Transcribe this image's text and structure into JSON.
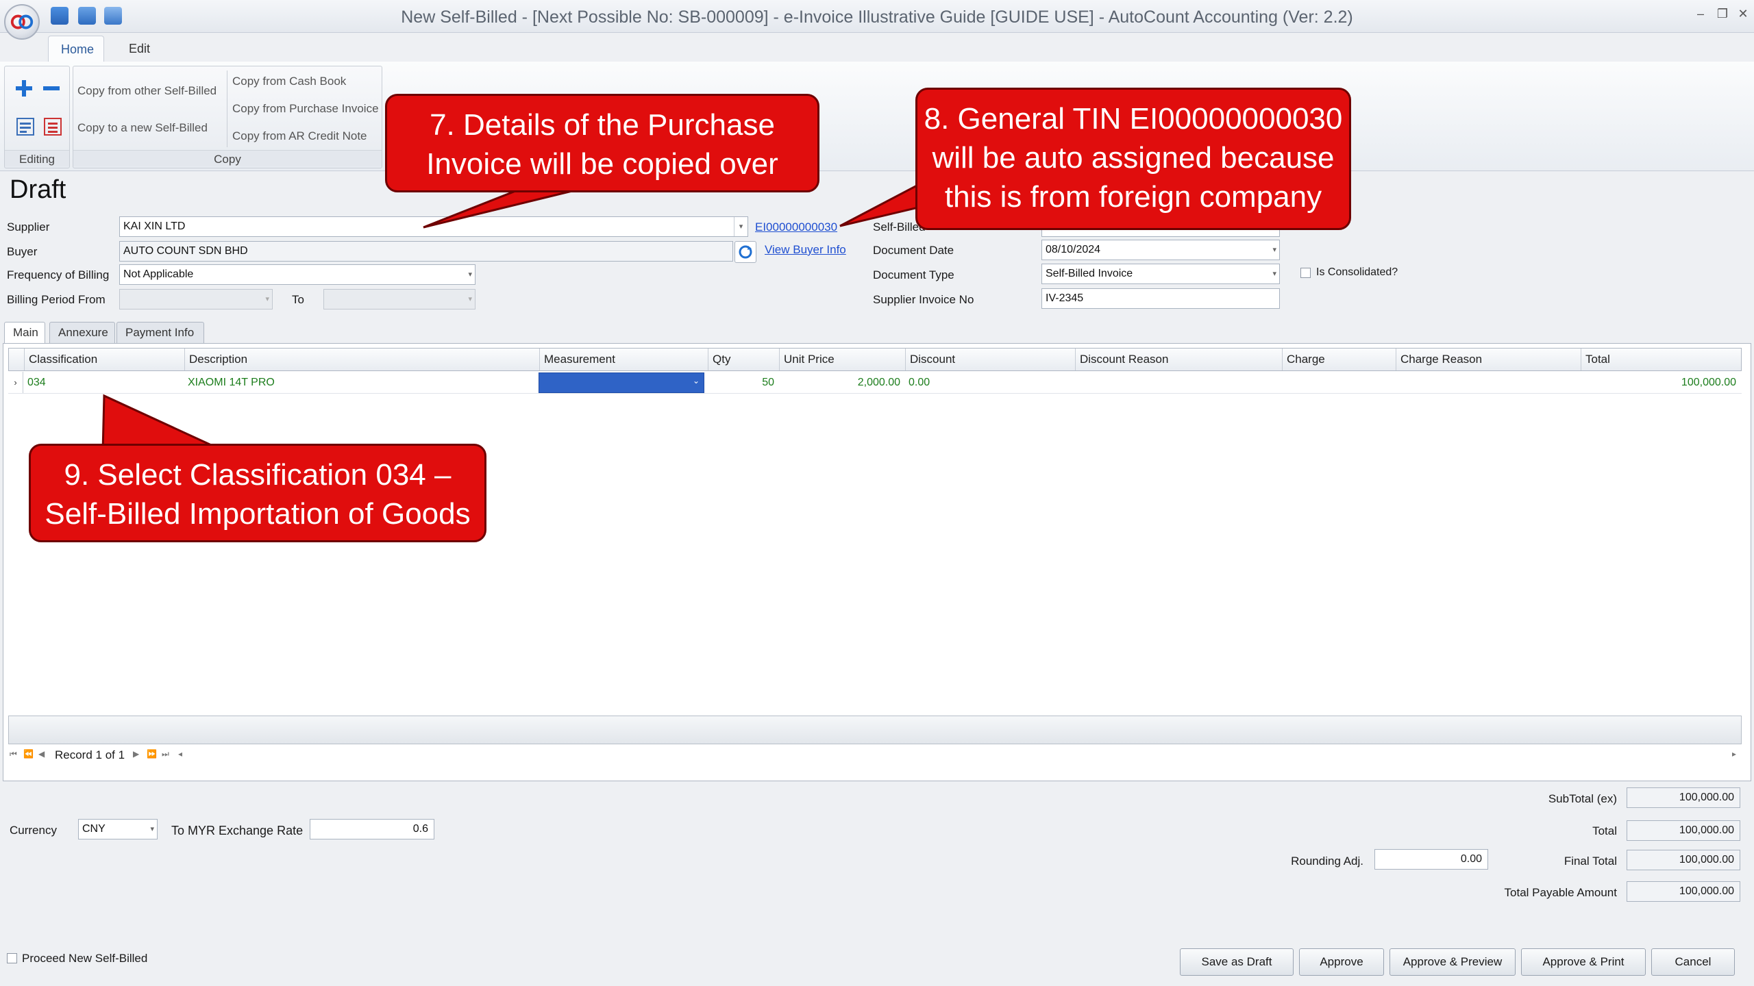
{
  "window": {
    "title": "New Self-Billed - [Next Possible No: SB-000009] - e-Invoice Illustrative Guide [GUIDE USE] - AutoCount Accounting (Ver: 2.2)"
  },
  "ribbon": {
    "tabs": [
      "Home",
      "Edit"
    ],
    "editing_label": "Editing",
    "copy_label": "Copy",
    "copy_from_other": "Copy from other Self-Billed",
    "copy_to_new": "Copy to a new Self-Billed",
    "copy_cash_book": "Copy from Cash Book",
    "copy_purchase_invoice": "Copy from Purchase Invoice",
    "copy_ar_credit_note": "Copy from AR Credit Note"
  },
  "form": {
    "status": "Draft",
    "supplier_label": "Supplier",
    "supplier_value": "KAI XIN LTD",
    "supplier_tin": "EI00000000030",
    "buyer_label": "Buyer",
    "buyer_value": "AUTO COUNT SDN BHD",
    "view_buyer_info": "View Buyer Info",
    "frequency_label": "Frequency of Billing",
    "frequency_value": "Not Applicable",
    "billing_period_label": "Billing Period From",
    "to_label": "To",
    "self_billed_label": "Self-Billed",
    "document_date_label": "Document Date",
    "document_date_value": "08/10/2024",
    "document_type_label": "Document Type",
    "document_type_value": "Self-Billed Invoice",
    "supplier_invoice_label": "Supplier Invoice No",
    "supplier_invoice_value": "IV-2345",
    "is_consolidated_label": "Is Consolidated?"
  },
  "grid_tabs": [
    "Main",
    "Annexure",
    "Payment Info"
  ],
  "grid": {
    "columns": [
      "Classification",
      "Description",
      "Measurement",
      "Qty",
      "Unit Price",
      "Discount",
      "Discount Reason",
      "Charge",
      "Charge Reason",
      "Total"
    ],
    "rows": [
      {
        "classification": "034",
        "description": "XIAOMI 14T PRO",
        "measurement": "",
        "qty": "50",
        "unit_price": "2,000.00",
        "discount": "0.00",
        "discount_reason": "",
        "charge": "",
        "charge_reason": "",
        "total": "100,000.00"
      }
    ],
    "record_text": "Record 1 of 1"
  },
  "currency": {
    "label": "Currency",
    "value": "CNY",
    "rate_label": "To MYR Exchange Rate",
    "rate_value": "0.6"
  },
  "totals": {
    "subtotal_label": "SubTotal (ex)",
    "subtotal_value": "100,000.00",
    "total_label": "Total",
    "total_value": "100,000.00",
    "rounding_label": "Rounding Adj.",
    "rounding_value": "0.00",
    "final_total_label": "Final Total",
    "final_total_value": "100,000.00",
    "payable_label": "Total Payable Amount",
    "payable_value": "100,000.00"
  },
  "proceed_label": "Proceed New Self-Billed",
  "buttons": {
    "save_draft": "Save as Draft",
    "approve": "Approve",
    "approve_preview": "Approve & Preview",
    "approve_print": "Approve & Print",
    "cancel": "Cancel"
  },
  "callouts": {
    "c7_line1": "7. Details of the Purchase",
    "c7_line2": "Invoice will be copied over",
    "c8_line1": "8. General TIN EI00000000030",
    "c8_line2": "will be auto assigned because",
    "c8_line3": "this is from foreign company",
    "c9_line1": "9. Select Classification 034 –",
    "c9_line2": "Self-Billed Importation of Goods"
  },
  "colors": {
    "callout": "#e00d0d",
    "grid_text": "#1c7d1c",
    "selected_cell": "#2f63c6",
    "link": "#1f4fd1"
  }
}
